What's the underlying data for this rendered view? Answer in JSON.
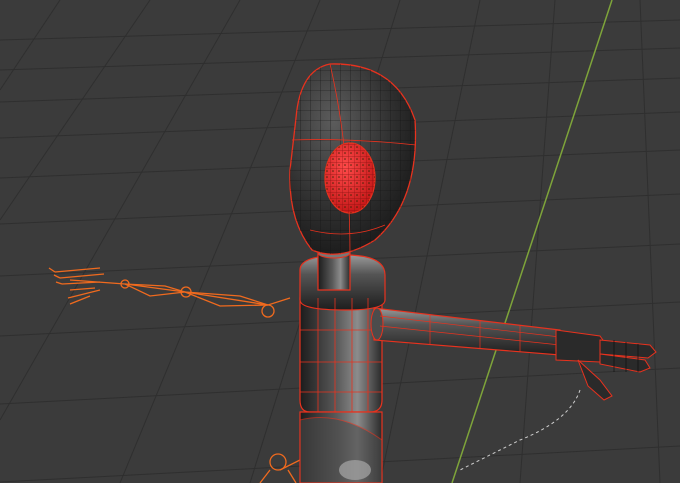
{
  "viewport": {
    "name": "3D Viewport",
    "background_color": "#3b3b3b",
    "grid_color": "#2f2f2f",
    "y_axis_color": "#7ea43a",
    "selection_outline_color": "#e8321e",
    "armature_color": "#f06a1e"
  },
  "scene": {
    "objects": [
      {
        "name": "head",
        "icon": "sphere-mesh",
        "selected": true
      },
      {
        "name": "eye",
        "icon": "sphere-mesh",
        "selected": true
      },
      {
        "name": "neck",
        "icon": "cylinder-mesh",
        "selected": true
      },
      {
        "name": "torso",
        "icon": "cylinder-mesh",
        "selected": true
      },
      {
        "name": "arm-right",
        "icon": "cylinder-mesh",
        "selected": true
      },
      {
        "name": "hand-right",
        "icon": "hand-mesh",
        "selected": true
      },
      {
        "name": "armature",
        "icon": "bone",
        "selected": false
      }
    ]
  }
}
